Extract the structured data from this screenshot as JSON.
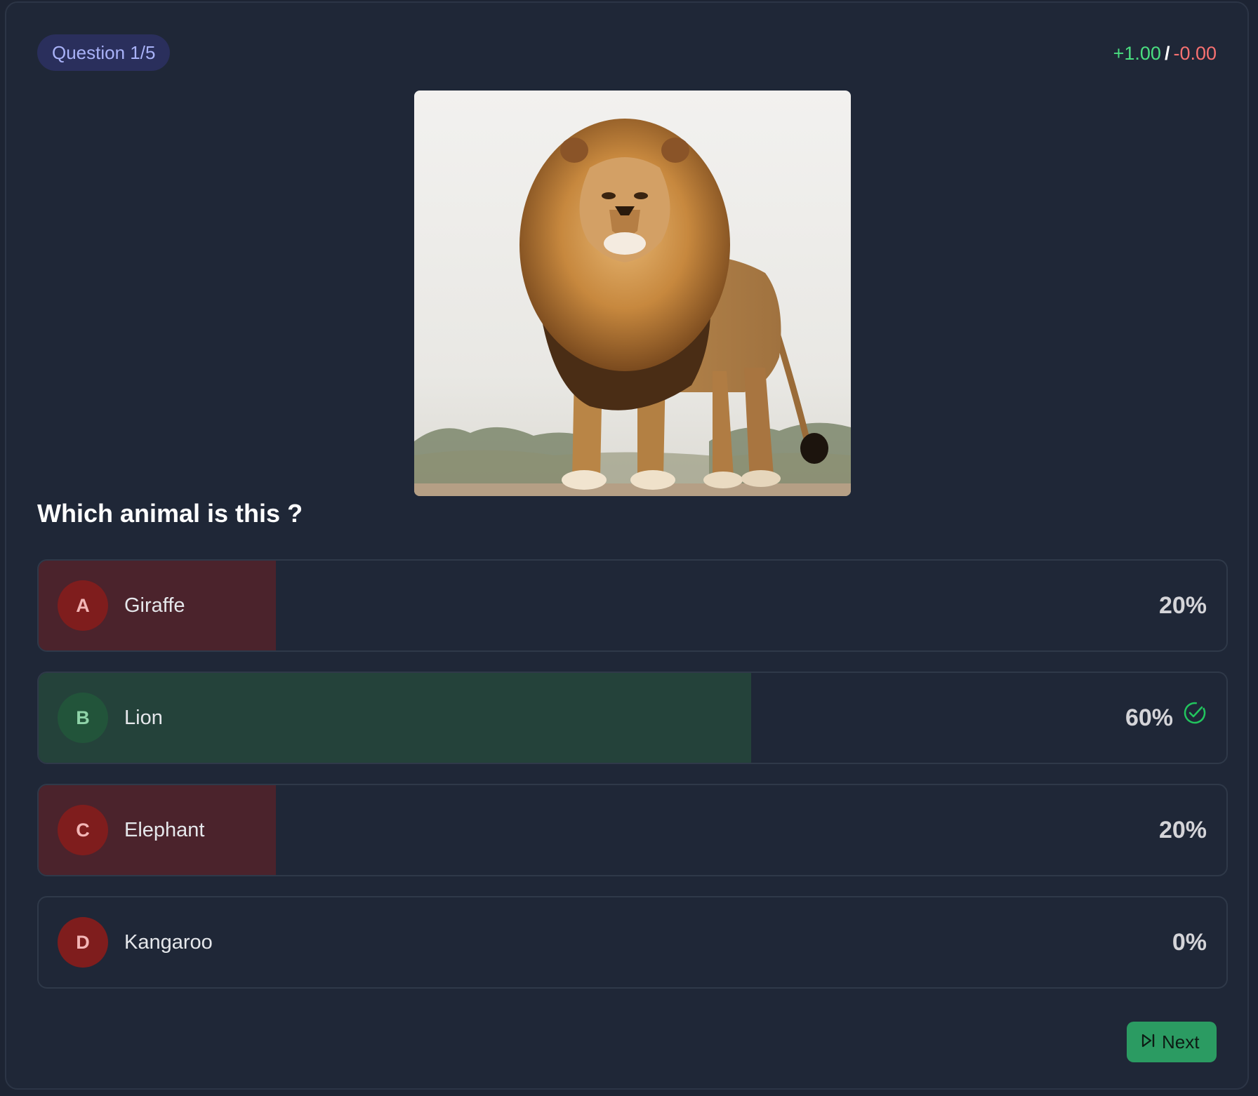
{
  "header": {
    "question_counter": "Question 1/5",
    "score_plus": "+1.00",
    "score_separator": "/",
    "score_minus": "-0.00"
  },
  "image": {
    "subject": "lion"
  },
  "question": "Which animal is this ?",
  "options": [
    {
      "letter": "A",
      "label": "Giraffe",
      "percent": "20%",
      "share": 0.2,
      "state": "incorrect",
      "icon": null
    },
    {
      "letter": "B",
      "label": "Lion",
      "percent": "60%",
      "share": 0.6,
      "state": "correct",
      "icon": "check-circle-icon"
    },
    {
      "letter": "C",
      "label": "Elephant",
      "percent": "20%",
      "share": 0.2,
      "state": "incorrect",
      "icon": null
    },
    {
      "letter": "D",
      "label": "Kangaroo",
      "percent": "0%",
      "share": 0.0,
      "state": "incorrect",
      "icon": null
    }
  ],
  "next_button": {
    "label": "Next",
    "icon": "skip-forward-icon"
  },
  "colors": {
    "background": "#1f2737",
    "correct_fill": "#24423a",
    "correct_badge": "#22543a",
    "correct_accent": "#22c55e",
    "incorrect_fill": "#4b232c",
    "incorrect_badge": "#7f1d1d",
    "button": "#2b9b62",
    "score_plus": "#4ade80",
    "score_minus": "#f87171",
    "badge_bg": "#2a2f5c",
    "badge_text": "#a9b2f8"
  }
}
